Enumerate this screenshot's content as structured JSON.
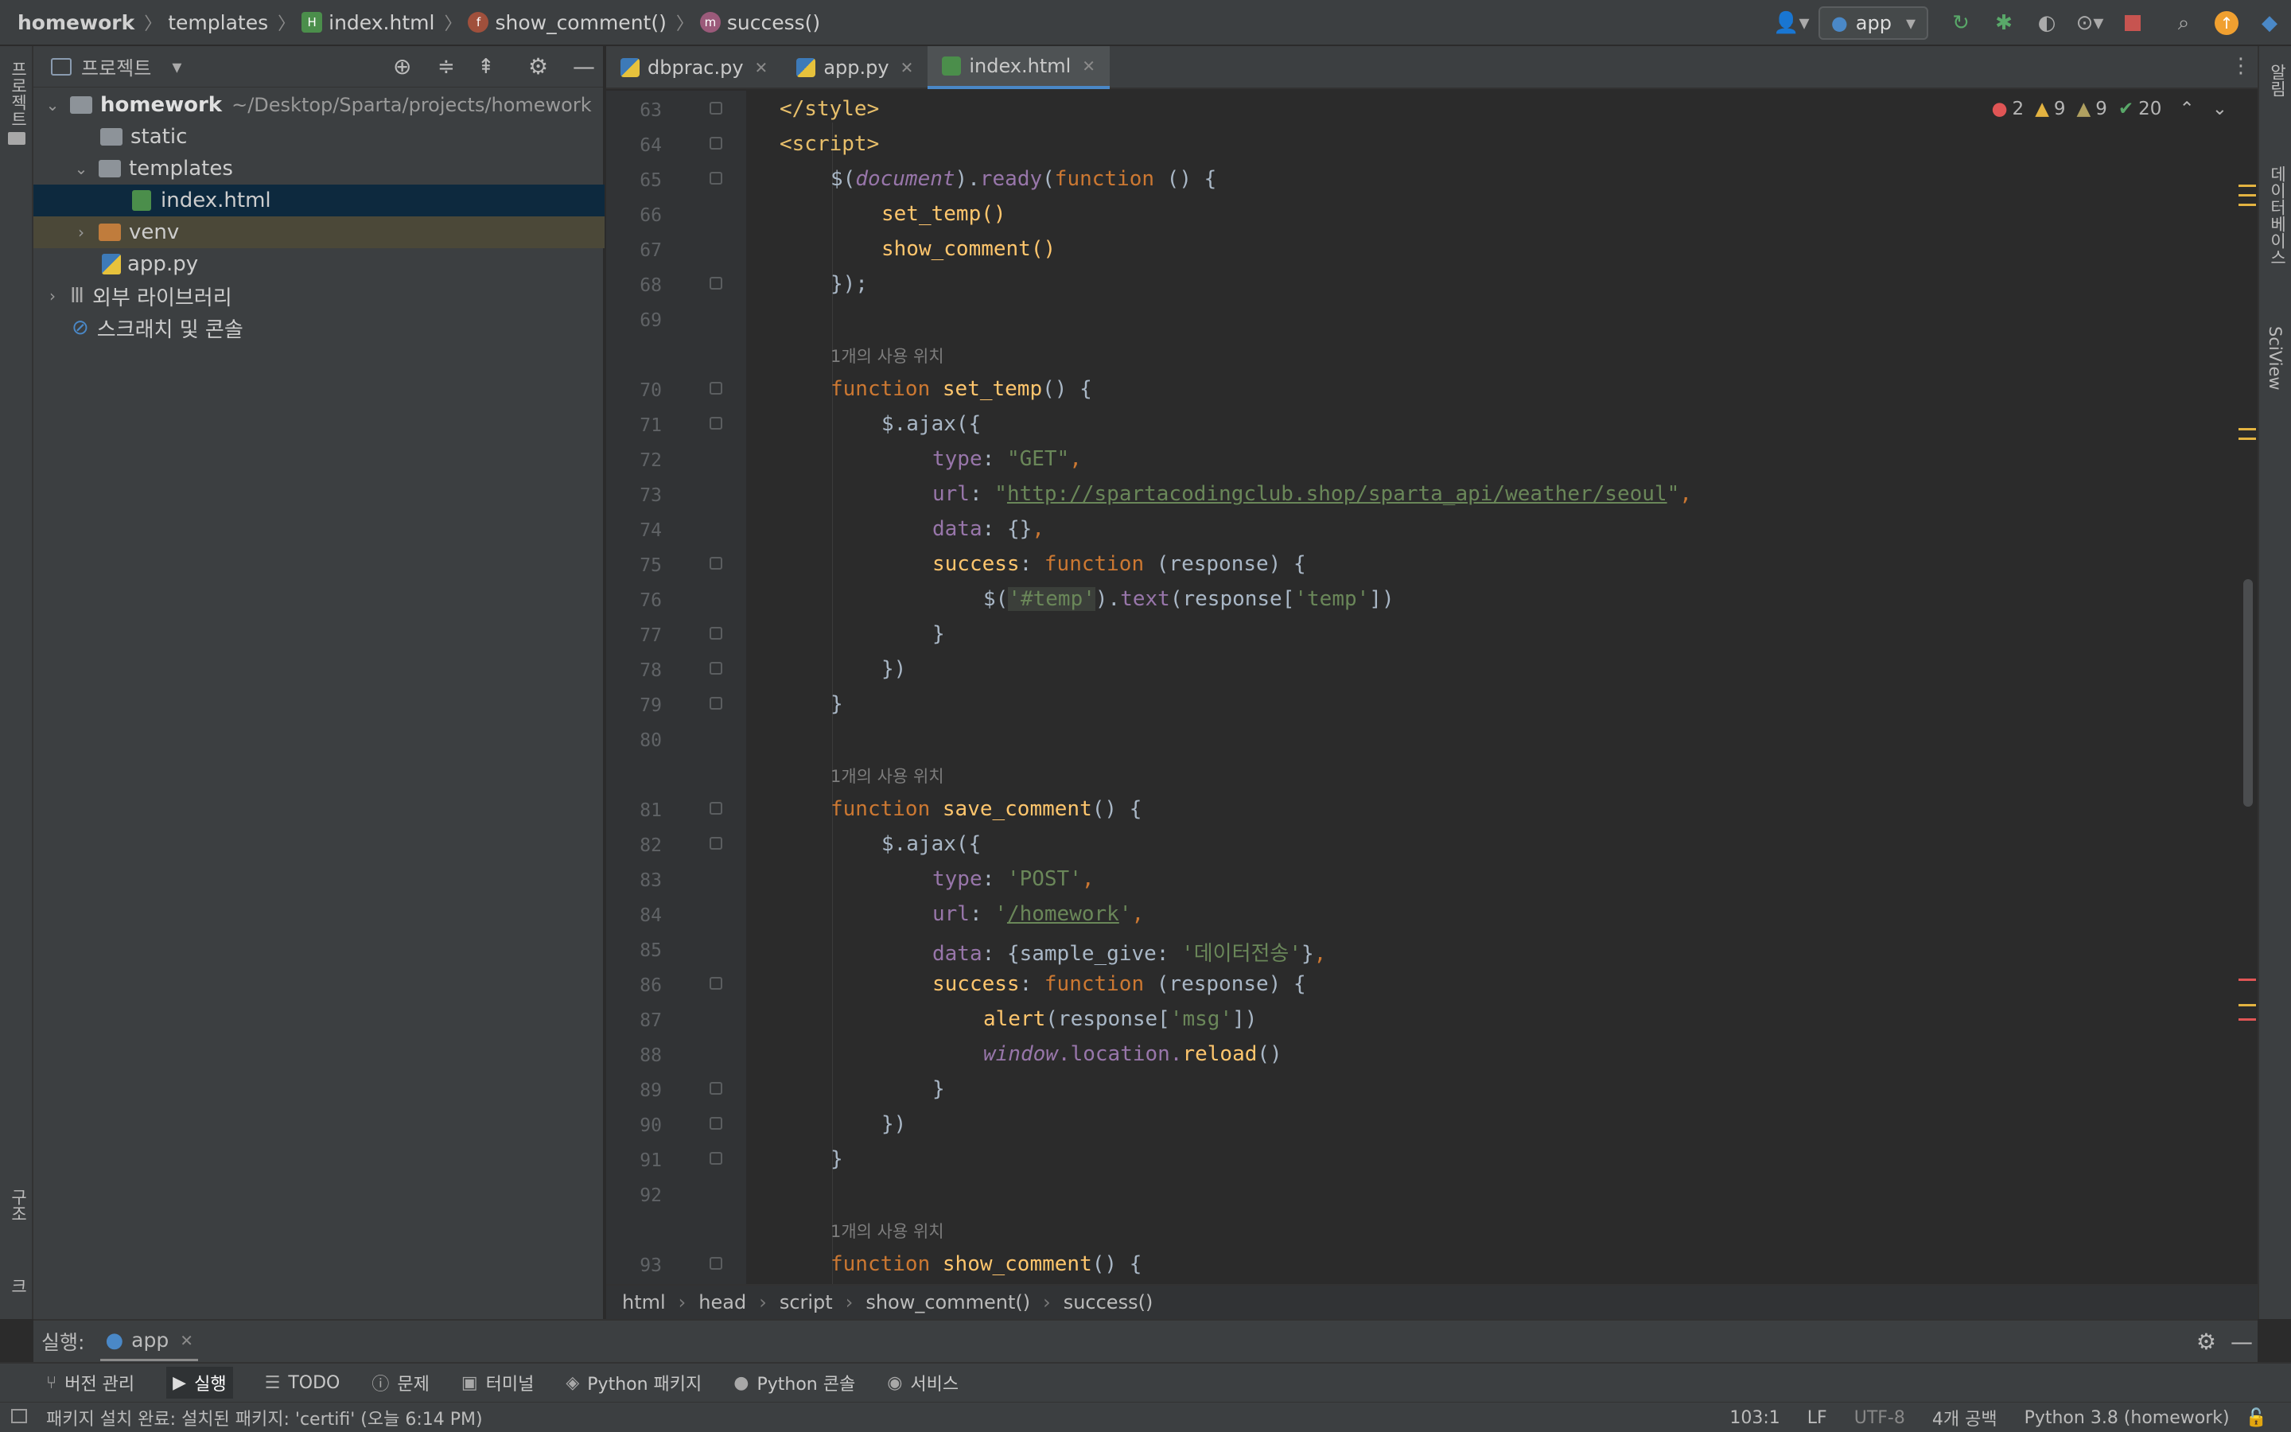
{
  "breadcrumb": {
    "project": "homework",
    "folder": "templates",
    "file": "index.html",
    "function": "show_comment()",
    "method": "success()"
  },
  "toolbar": {
    "run_config": "app"
  },
  "left_strip": {
    "project_label": "프로젝트",
    "structure_label": "구조",
    "bookmarks_label": "북마크"
  },
  "right_strip": {
    "notifications_label": "알림",
    "database_label": "데이터베이스",
    "sciview_label": "SciView"
  },
  "project_panel": {
    "title": "프로젝트",
    "root_name": "homework",
    "root_path": "~/Desktop/Sparta/projects/homework",
    "items": [
      {
        "label": "static"
      },
      {
        "label": "templates"
      },
      {
        "label": "index.html"
      },
      {
        "label": "venv"
      },
      {
        "label": "app.py"
      },
      {
        "label": "외부 라이브러리"
      },
      {
        "label": "스크래치 및 콘솔"
      }
    ]
  },
  "tabs": [
    {
      "label": "dbprac.py"
    },
    {
      "label": "app.py"
    },
    {
      "label": "index.html"
    }
  ],
  "inspections": {
    "errors": "2",
    "warnings": "9",
    "weak_warnings": "9",
    "ok": "20"
  },
  "editor": {
    "usage_hint": "1개의 사용 위치",
    "line_numbers": [
      "63",
      "64",
      "65",
      "66",
      "67",
      "68",
      "69",
      "70",
      "71",
      "72",
      "73",
      "74",
      "75",
      "76",
      "77",
      "78",
      "79",
      "80",
      "81",
      "82",
      "83",
      "84",
      "85",
      "86",
      "87",
      "88",
      "89",
      "90",
      "91",
      "92",
      "93"
    ],
    "code": {
      "l63": "</style>",
      "l64": "<script>",
      "l65_a": "$(",
      "l65_b": "document",
      "l65_c": ").",
      "l65_d": "ready",
      "l65_e": "(",
      "l65_f": "function",
      "l65_g": " () {",
      "l66": "set_temp()",
      "l67": "show_comment()",
      "l68": "});",
      "l70_kw": "function ",
      "l70_fn": "set_temp",
      "l70_rest": "() {",
      "l71": "$.ajax({",
      "l72_k": "type",
      "l72_v": "\"GET\"",
      "l73_k": "url",
      "l73_v": "http://spartacodingclub.shop/sparta_api/weather/seoul",
      "l74_k": "data",
      "l74_v": "{}",
      "l75_k": "success",
      "l75_kw": "function",
      "l75_rest": " (response) {",
      "l76_a": "$(",
      "l76_b": "'#temp'",
      "l76_c": ").",
      "l76_d": "text",
      "l76_e": "(response[",
      "l76_f": "'temp'",
      "l76_g": "])",
      "l77": "}",
      "l78": "})",
      "l79": "}",
      "l81_kw": "function ",
      "l81_fn": "save_comment",
      "l81_rest": "() {",
      "l82": "$.ajax({",
      "l83_k": "type",
      "l83_v": "'POST'",
      "l84_k": "url",
      "l84_v": "/homework",
      "l85_k": "data",
      "l85_a": "{sample_give: ",
      "l85_v": "'데이터전송'",
      "l85_c": "}",
      "l86_k": "success",
      "l86_kw": "function",
      "l86_rest": " (response) {",
      "l87_fn": "alert",
      "l87_a": "(response[",
      "l87_v": "'msg'",
      "l87_c": "])",
      "l88_a": "window",
      "l88_b": ".location.",
      "l88_c": "reload",
      "l88_d": "()",
      "l89": "}",
      "l90": "})",
      "l91": "}",
      "l93_kw": "function ",
      "l93_fn": "show_comment",
      "l93_rest": "() {"
    }
  },
  "editor_breadcrumb": [
    "html",
    "head",
    "script",
    "show_comment()",
    "success()"
  ],
  "run": {
    "label": "실행:",
    "config": "app"
  },
  "tool_windows": [
    {
      "label": "버전 관리"
    },
    {
      "label": "실행"
    },
    {
      "label": "TODO"
    },
    {
      "label": "문제"
    },
    {
      "label": "터미널"
    },
    {
      "label": "Python 패키지"
    },
    {
      "label": "Python 콘솔"
    },
    {
      "label": "서비스"
    }
  ],
  "status": {
    "message": "패키지 설치 완료: 설치된 패키지: 'certifi' (오늘 6:14 PM)",
    "position": "103:1",
    "line_sep": "LF",
    "encoding": "UTF-8",
    "indent": "4개 공백",
    "interpreter": "Python 3.8 (homework)"
  },
  "colors": {
    "accent": "#4a88c7",
    "keyword": "#cc7832",
    "string": "#6a8759",
    "function": "#ffc66d",
    "error": "#e05555",
    "warning": "#e3b341"
  }
}
